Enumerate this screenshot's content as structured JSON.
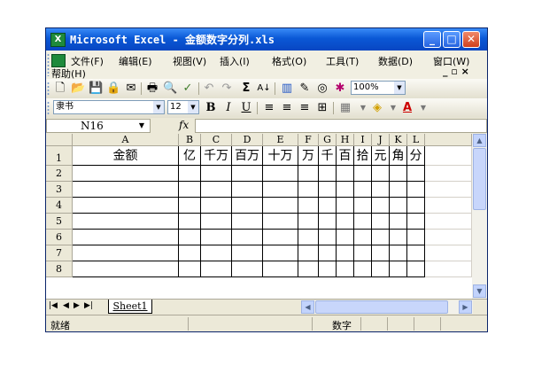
{
  "window": {
    "title": "Microsoft Excel - 金额数字分列.xls",
    "app_icon": "excel-icon",
    "controls": {
      "minimize": "_",
      "maximize": "□",
      "close": "✕"
    }
  },
  "menu": {
    "items": [
      "文件(F)",
      "编辑(E)",
      "视图(V)",
      "插入(I)",
      "格式(O)",
      "工具(T)",
      "数据(D)",
      "窗口(W)"
    ],
    "help": "帮助(H)",
    "mdi_controls": "_ ▫ ×"
  },
  "toolbar": {
    "zoom": "100%",
    "font_name": "隶书",
    "font_size": "12",
    "bold": "B",
    "italic": "I",
    "underline": "U",
    "sum": "Σ",
    "font_color_label": "A"
  },
  "formula_bar": {
    "name_box": "N16",
    "fx": "fx",
    "formula": ""
  },
  "sheet": {
    "columns": [
      "A",
      "B",
      "C",
      "D",
      "E",
      "F",
      "G",
      "H",
      "I",
      "J",
      "K",
      "L"
    ],
    "rows": [
      "1",
      "2",
      "3",
      "4",
      "5",
      "6",
      "7",
      "8"
    ],
    "row1": [
      "金额",
      "亿",
      "千万",
      "百万",
      "十万",
      "万",
      "千",
      "百",
      "拾",
      "元",
      "角",
      "分"
    ]
  },
  "tabs": {
    "active": "Sheet1"
  },
  "status": {
    "ready": "就绪",
    "mode": "数字"
  },
  "colors": {
    "title_bar": "#0a58d6",
    "close_button": "#d0401d",
    "excel_green": "#1f8a3b"
  }
}
